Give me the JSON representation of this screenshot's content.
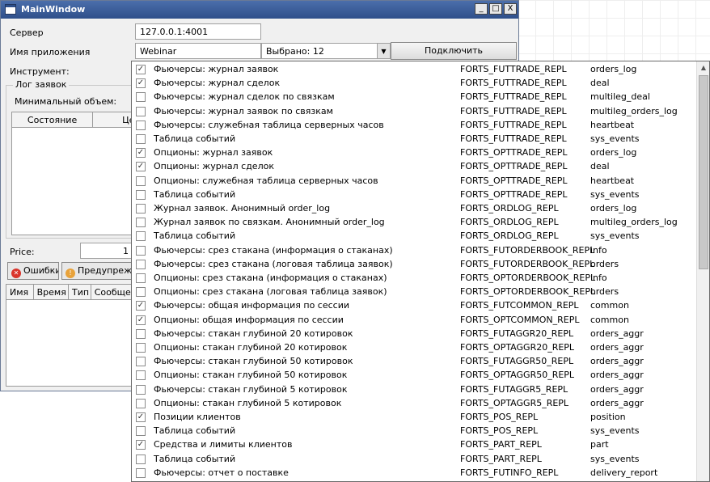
{
  "window": {
    "title": "MainWindow",
    "buttons": {
      "minimize": "_",
      "maximize": "□",
      "close": "X"
    }
  },
  "form": {
    "server_label": "Сервер",
    "server_value": "127.0.0.1:4001",
    "app_label": "Имя приложения",
    "app_value": "Webinar",
    "selected_text": "Выбрано: 12",
    "connect_label": "Подключить",
    "instrument_label": "Инструмент:",
    "orders_log_group": "Лог заявок",
    "min_volume_label": "Минимальный объем:",
    "grid_col_state": "Состояние",
    "grid_col_partial": "Це",
    "price_label": "Price:",
    "price_value_partial": "1"
  },
  "tabs": {
    "errors": "Ошибки",
    "warnings": "Предупрежде"
  },
  "log_grid": {
    "columns": [
      "Имя",
      "Время",
      "Тип",
      "Сообщени"
    ]
  },
  "popup": {
    "scroll_up": "▲",
    "scroll_down": "▼",
    "items": [
      {
        "checked": true,
        "name": "Фьючерсы: журнал заявок",
        "stream": "FORTS_FUTTRADE_REPL",
        "table": "orders_log"
      },
      {
        "checked": true,
        "name": "Фьючерсы: журнал сделок",
        "stream": "FORTS_FUTTRADE_REPL",
        "table": "deal"
      },
      {
        "checked": false,
        "name": "Фьючерсы: журнал сделок по связкам",
        "stream": "FORTS_FUTTRADE_REPL",
        "table": "multileg_deal"
      },
      {
        "checked": false,
        "name": "Фьючерсы: журнал заявок по связкам",
        "stream": "FORTS_FUTTRADE_REPL",
        "table": "multileg_orders_log"
      },
      {
        "checked": false,
        "name": "Фьючерсы: служебная таблица серверных часов",
        "stream": "FORTS_FUTTRADE_REPL",
        "table": "heartbeat"
      },
      {
        "checked": false,
        "name": "Таблица событий",
        "stream": "FORTS_FUTTRADE_REPL",
        "table": "sys_events"
      },
      {
        "checked": true,
        "name": "Опционы: журнал заявок",
        "stream": "FORTS_OPTTRADE_REPL",
        "table": "orders_log"
      },
      {
        "checked": true,
        "name": "Опционы: журнал сделок",
        "stream": "FORTS_OPTTRADE_REPL",
        "table": "deal"
      },
      {
        "checked": false,
        "name": "Опционы: служебная таблица серверных часов",
        "stream": "FORTS_OPTTRADE_REPL",
        "table": "heartbeat"
      },
      {
        "checked": false,
        "name": "Таблица событий",
        "stream": "FORTS_OPTTRADE_REPL",
        "table": "sys_events"
      },
      {
        "checked": false,
        "name": "Журнал заявок. Анонимный order_log",
        "stream": "FORTS_ORDLOG_REPL",
        "table": "orders_log"
      },
      {
        "checked": false,
        "name": "Журнал заявок по связкам. Анонимный order_log",
        "stream": "FORTS_ORDLOG_REPL",
        "table": "multileg_orders_log"
      },
      {
        "checked": false,
        "name": "Таблица событий",
        "stream": "FORTS_ORDLOG_REPL",
        "table": "sys_events"
      },
      {
        "checked": false,
        "name": "Фьючерсы: срез стакана (информация о стаканах)",
        "stream": "FORTS_FUTORDERBOOK_REPL",
        "table": "info"
      },
      {
        "checked": false,
        "name": "Фьючерсы: срез стакана (логовая таблица заявок)",
        "stream": "FORTS_FUTORDERBOOK_REPL",
        "table": "orders"
      },
      {
        "checked": false,
        "name": "Опционы: срез стакана (информация о стаканах)",
        "stream": "FORTS_OPTORDERBOOK_REPL",
        "table": "info"
      },
      {
        "checked": false,
        "name": "Опционы: срез стакана (логовая таблица заявок)",
        "stream": "FORTS_OPTORDERBOOK_REPL",
        "table": "orders"
      },
      {
        "checked": true,
        "name": "Фьючерсы: общая информация по сессии",
        "stream": "FORTS_FUTCOMMON_REPL",
        "table": "common"
      },
      {
        "checked": true,
        "name": "Опционы: общая информация по сессии",
        "stream": "FORTS_OPTCOMMON_REPL",
        "table": "common"
      },
      {
        "checked": false,
        "name": "Фьючерсы: стакан глубиной 20 котировок",
        "stream": "FORTS_FUTAGGR20_REPL",
        "table": "orders_aggr"
      },
      {
        "checked": false,
        "name": "Опционы: стакан глубиной 20 котировок",
        "stream": "FORTS_OPTAGGR20_REPL",
        "table": "orders_aggr"
      },
      {
        "checked": false,
        "name": "Фьючерсы: стакан глубиной 50 котировок",
        "stream": "FORTS_FUTAGGR50_REPL",
        "table": "orders_aggr"
      },
      {
        "checked": false,
        "name": "Опционы: стакан глубиной 50 котировок",
        "stream": "FORTS_OPTAGGR50_REPL",
        "table": "orders_aggr"
      },
      {
        "checked": false,
        "name": "Фьючерсы: стакан глубиной 5 котировок",
        "stream": "FORTS_FUTAGGR5_REPL",
        "table": "orders_aggr"
      },
      {
        "checked": false,
        "name": "Опционы: стакан глубиной 5 котировок",
        "stream": "FORTS_OPTAGGR5_REPL",
        "table": "orders_aggr"
      },
      {
        "checked": true,
        "name": "Позиции клиентов",
        "stream": "FORTS_POS_REPL",
        "table": "position"
      },
      {
        "checked": false,
        "name": "Таблица событий",
        "stream": "FORTS_POS_REPL",
        "table": "sys_events"
      },
      {
        "checked": true,
        "name": "Средства и лимиты клиентов",
        "stream": "FORTS_PART_REPL",
        "table": "part"
      },
      {
        "checked": false,
        "name": "Таблица событий",
        "stream": "FORTS_PART_REPL",
        "table": "sys_events"
      },
      {
        "checked": false,
        "name": "Фьючерсы: отчет о поставке",
        "stream": "FORTS_FUTINFO_REPL",
        "table": "delivery_report"
      }
    ]
  }
}
